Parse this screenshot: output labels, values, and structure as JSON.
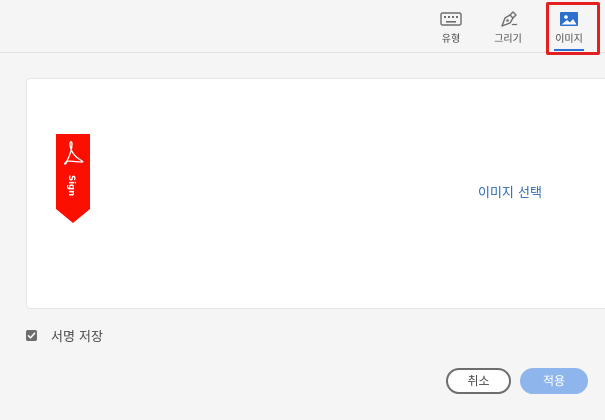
{
  "toolbar": {
    "tabs": [
      {
        "label": "유형",
        "icon": "keyboard-icon"
      },
      {
        "label": "그리기",
        "icon": "pen-icon"
      },
      {
        "label": "이미지",
        "icon": "image-icon",
        "selected": true
      }
    ]
  },
  "panel": {
    "select_image_label": "이미지 선택",
    "logo_text": "Sign",
    "logo_color": "#fa0f00"
  },
  "save_signature": {
    "label": "서명 저장",
    "checked": true
  },
  "actions": {
    "cancel_label": "취소",
    "apply_label": "적용"
  },
  "colors": {
    "accent": "#2d6fcf",
    "highlight_box": "#e41f1f",
    "apply_disabled": "#8fb6ec"
  }
}
